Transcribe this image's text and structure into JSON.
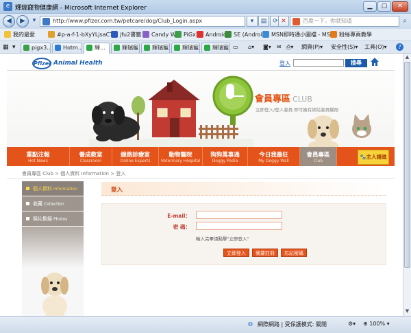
{
  "window": {
    "title": "輝瑞寵物健康網 - Microsoft Internet Explorer"
  },
  "address": {
    "url": "http://www.pfizer.com.tw/petcare/dog/Club_Login.aspx",
    "search_placeholder": "百度一下，你就知道"
  },
  "favorites": {
    "label": "我的最愛",
    "items": [
      {
        "label": "#p-a-f-1-bXyYLjsaCT8",
        "color": "#e0a030"
      },
      {
        "label": "jfu2書籤",
        "color": "#2a5bb8"
      },
      {
        "label": "Candy Wu",
        "color": "#8a62c5"
      },
      {
        "label": "PiGx3",
        "color": "#3ca04a"
      },
      {
        "label": "Android",
        "color": "#d33"
      },
      {
        "label": "SE (Android)",
        "color": "#3a8c3a"
      },
      {
        "label": "MSN即時通小圖檔 - MS...",
        "color": "#3d8ad6"
      },
      {
        "label": "粉絲專頁教學",
        "color": "#e07a1a"
      }
    ]
  },
  "tabs": [
    {
      "label": "pigx3...",
      "active": false
    },
    {
      "label": "Hotm...",
      "active": false
    },
    {
      "label": "輝...",
      "active": true
    },
    {
      "label": "輝瑞寵...",
      "active": false
    },
    {
      "label": "輝瑞寵...",
      "active": false
    },
    {
      "label": "輝瑞寵...",
      "active": false
    },
    {
      "label": "輝瑞寵...",
      "active": false
    }
  ],
  "toolbar": {
    "page_label": "網頁(P)",
    "safety_label": "安全性(S)",
    "tools_label": "工具(O)",
    "help_glyph": "?"
  },
  "site": {
    "brand": "Pfizer",
    "brand_sub": "Animal Health",
    "login_link": "登入",
    "search_button": "搜尋",
    "club_title": "會員專區",
    "club_title_en": "CLUB",
    "club_subtitle": "立即登入/登入會員 即可擁有網站會員權限",
    "owner_login": "主人請進",
    "nav": [
      {
        "zh": "重點注報",
        "en": "Hot News"
      },
      {
        "zh": "養成教室",
        "en": "Classroom"
      },
      {
        "zh": "線路診療室",
        "en": "Online Experts"
      },
      {
        "zh": "動物醫院",
        "en": "Veterinary Hospital"
      },
      {
        "zh": "狗狗萬事通",
        "en": "Doggy Pedia"
      },
      {
        "zh": "今日我最狂",
        "en": "My Doggy Wall"
      },
      {
        "zh": "會員專區",
        "en": "Club"
      }
    ],
    "breadcrumb": "會員專區 Club  >  個人資料 Information  >  登入",
    "sidebar": [
      {
        "zh": "個人資料",
        "en": "Information",
        "active": true
      },
      {
        "zh": "收藏",
        "en": "Collection",
        "active": false
      },
      {
        "zh": "照片集錦",
        "en": "Photos",
        "active": false
      }
    ],
    "login": {
      "heading": "登入",
      "email_label": "E-mail：",
      "password_label": "密  碼：",
      "hint": "輸入完畢請點擊\"立即登入\"",
      "submit": "立即登入",
      "register": "我要註冊",
      "forgot": "忘記密碼"
    }
  },
  "status": {
    "zone": "網際網路 | 受保護模式: 關閉",
    "zoom": "100%"
  },
  "colors": {
    "nav_orange": "#e4531a",
    "brand_blue": "#1d5fb0",
    "sidebar_gray": "#9e958e",
    "owner_yellow": "#f8d23a"
  }
}
